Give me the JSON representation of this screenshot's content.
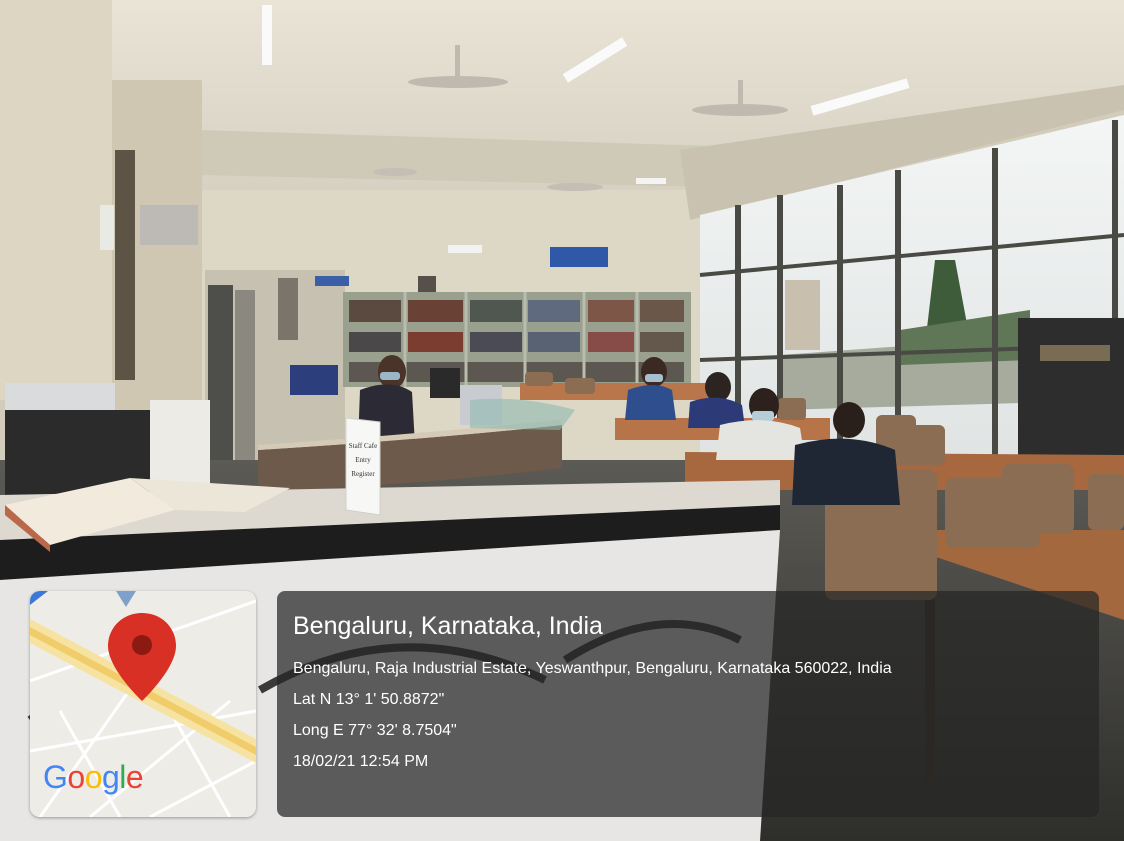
{
  "location": {
    "title": "Bengaluru, Karnataka, India",
    "address": "Bengaluru, Raja Industrial Estate, Yeswanthpur, Bengaluru, Karnataka 560022, India",
    "latitude": "Lat N 13° 1' 50.8872\"",
    "longitude": "Long E 77° 32' 8.7504\"",
    "timestamp": "18/02/21 12:54 PM"
  },
  "map": {
    "logo_letters": [
      "G",
      "o",
      "o",
      "g",
      "l",
      "e"
    ],
    "logo_colors": [
      "#4285F4",
      "#EA4335",
      "#FBBC05",
      "#4285F4",
      "#34A853",
      "#EA4335"
    ],
    "pin_color": "#D93025",
    "marker_icon": "map-pin-icon"
  },
  "scene": {
    "sign_text": [
      "Staff Cafe",
      "Entry",
      "Register"
    ]
  }
}
